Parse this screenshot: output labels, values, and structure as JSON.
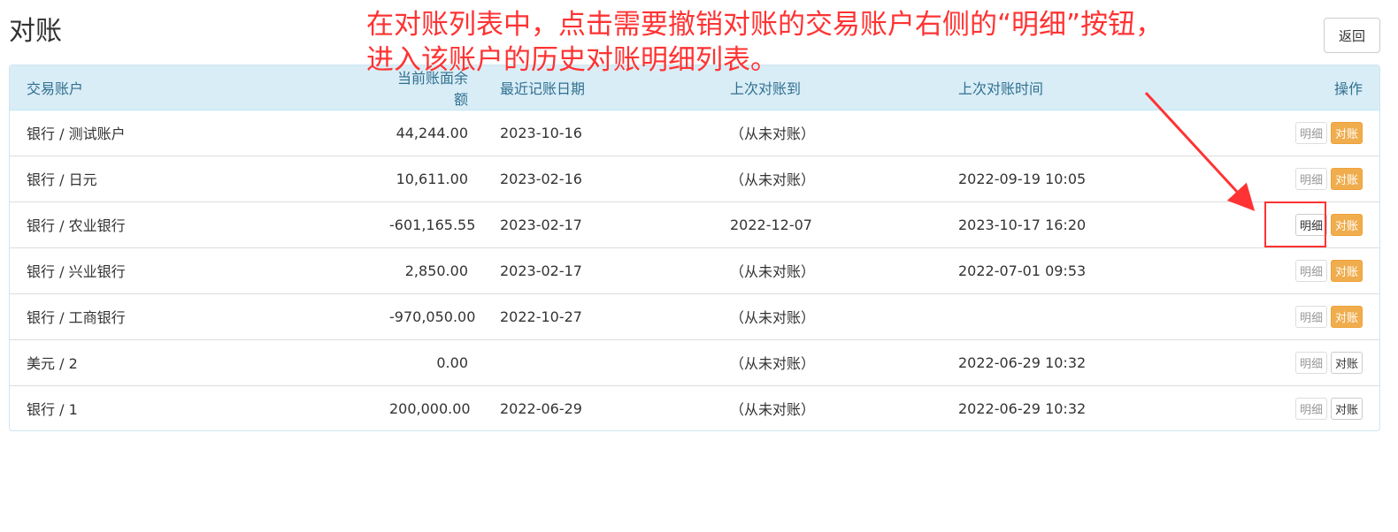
{
  "page": {
    "title": "对账",
    "back_label": "返回"
  },
  "annotation": {
    "line1": "在对账列表中，点击需要撤销对账的交易账户右侧的“明细”按钮，",
    "line2": "进入该账户的历史对账明细列表。",
    "color": "#ff3333"
  },
  "table": {
    "headers": {
      "account": "交易账户",
      "balance": "当前账面余额",
      "last_record_date": "最近记账日期",
      "last_reconciled_to": "上次对账到",
      "last_reconcile_time": "上次对账时间",
      "actions": "操作"
    },
    "detail_label": "明细",
    "reconcile_label": "对账",
    "rows": [
      {
        "account": "银行 / 测试账户",
        "balance": "44,244.00",
        "last_record_date": "2023-10-16",
        "last_reconciled_to": "（从未对账）",
        "last_reconcile_time": ""
      },
      {
        "account": "银行 / 日元",
        "balance": "10,611.00",
        "last_record_date": "2023-02-16",
        "last_reconciled_to": "（从未对账）",
        "last_reconcile_time": "2022-09-19 10:05"
      },
      {
        "account": "银行 / 农业银行",
        "balance": "-601,165.55",
        "last_record_date": "2023-02-17",
        "last_reconciled_to": "2022-12-07",
        "last_reconcile_time": "2023-10-17 16:20"
      },
      {
        "account": "银行 / 兴业银行",
        "balance": "2,850.00",
        "last_record_date": "2023-02-17",
        "last_reconciled_to": "（从未对账）",
        "last_reconcile_time": "2022-07-01 09:53"
      },
      {
        "account": "银行 / 工商银行",
        "balance": "-970,050.00",
        "last_record_date": "2022-10-27",
        "last_reconciled_to": "（从未对账）",
        "last_reconcile_time": ""
      },
      {
        "account": "美元 / 2",
        "balance": "0.00",
        "last_record_date": "",
        "last_reconciled_to": "（从未对账）",
        "last_reconcile_time": "2022-06-29 10:32"
      },
      {
        "account": "银行 / 1",
        "balance": "200,000.00",
        "last_record_date": "2022-06-29",
        "last_reconciled_to": "（从未对账）",
        "last_reconcile_time": "2022-06-29 10:32"
      }
    ]
  }
}
